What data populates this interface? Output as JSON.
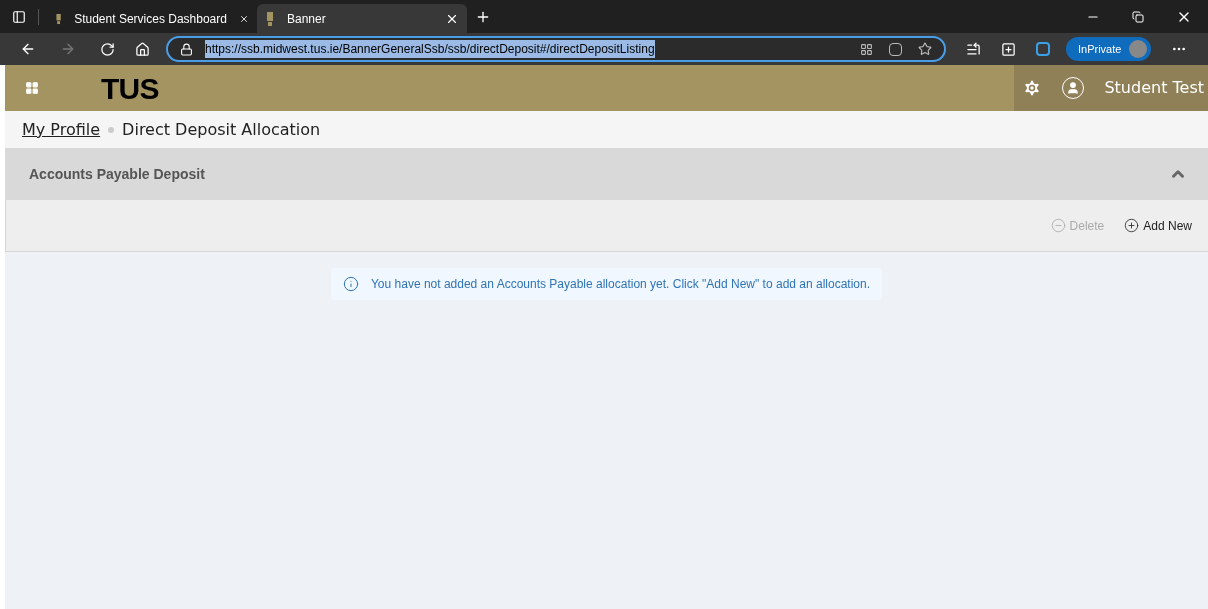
{
  "browser": {
    "tabs": [
      {
        "label": "Student Services Dashboard",
        "selected": false
      },
      {
        "label": "Banner",
        "selected": true
      }
    ],
    "url": "https://ssb.midwest.tus.ie/BannerGeneralSsb/ssb/directDeposit#/directDepositListing",
    "inprivate": "InPrivate"
  },
  "header": {
    "logo": "TUS",
    "user": "Student Test"
  },
  "breadcrumb": [
    {
      "label": "My Profile",
      "kind": "link"
    },
    {
      "label": "Direct Deposit Allocation",
      "kind": "current"
    }
  ],
  "section": {
    "title": "Accounts Payable Deposit",
    "expanded": true
  },
  "toolbar": [
    {
      "label": "Delete",
      "kind": "remove",
      "disabled": true
    },
    {
      "label": "Add New",
      "kind": "add",
      "disabled": false
    }
  ],
  "notice": "You have not added an Accounts Payable allocation yet. Click \"Add New\" to add an allocation."
}
